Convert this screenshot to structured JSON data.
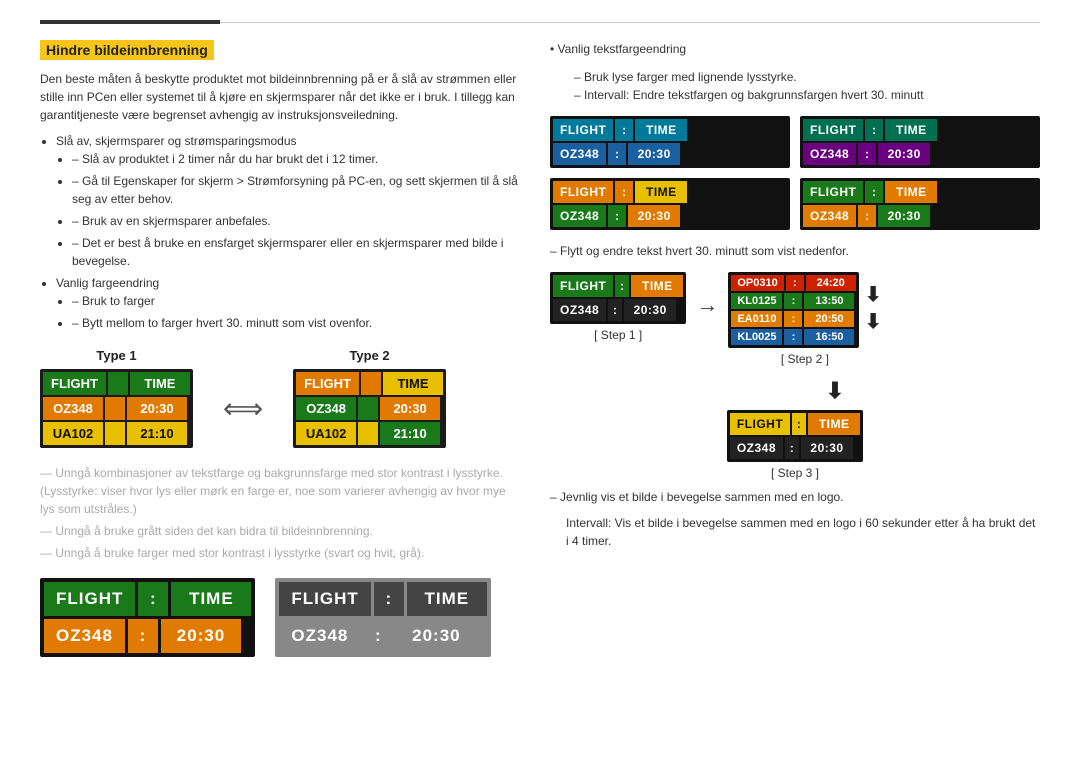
{
  "page": {
    "title": "Hindre bildeinnbrenning",
    "left": {
      "intro": "Den beste måten å beskytte produktet mot bildeinnbrenning på er å slå av strømmen eller stille inn PCen eller systemet til å kjøre en skjermsparer når det ikke er i bruk. I tillegg kan garantitjeneste være begrenset avhengig av instruksjonsveiledning.",
      "bullets": [
        {
          "text": "Slå av, skjermsparer og strømsparingsmodus",
          "sub": [
            "Slå av produktet i 2 timer når du har brukt det i 12 timer.",
            "Gå til Egenskaper for skjerm > Strømforsyning på PC-en, og sett skjermen til å slå seg av etter behov.",
            "Bruk av en skjermsparer anbefales.",
            "Det er best å bruke en ensfarget skjermsparer eller en skjermsparer med bilde i bevegelse."
          ]
        },
        {
          "text": "Vanlig fargeendring",
          "sub": [
            "Bruk to farger",
            "Bytt mellom to farger hvert 30. minutt som vist ovenfor."
          ]
        }
      ],
      "type1_label": "Type 1",
      "type2_label": "Type 2",
      "avoid_notes": [
        "Unngå kombinasjoner av tekstfarge og bakgrunnsfarge med stor kontrast i lysstyrke. (Lysstyrke: viser hvor lys eller mørk en farge er, noe som varierer avhengig av hvor mye lys som utstråles.)",
        "Unngå å bruke grått siden det kan bidra til bildeinnbrenning.",
        "Unngå å bruke farger med stor kontrast i lysstyrke (svart og hvit, grå)."
      ]
    },
    "right": {
      "vanlig_note": "Vanlig tekstfargeendring",
      "vanlig_sub": [
        "Bruk lyse farger med lignende lysstyrke.",
        "Intervall: Endre tekstfargen og bakgrunnsfargen hvert 30. minutt"
      ],
      "flytt_note": "Flytt og endre tekst hvert 30. minutt som vist nedenfor.",
      "step1_label": "[ Step 1 ]",
      "step2_label": "[ Step 2 ]",
      "step3_label": "[ Step 3 ]",
      "final_note1": "Jevnlig vis et bilde i bevegelse sammen med en logo.",
      "final_note2": "Intervall: Vis et bilde i bevegelse sammen med en logo i 60 sekunder etter å ha brukt det i 4 timer."
    },
    "boards": {
      "flight": "FLIGHT",
      "colon": ":",
      "time": "TIME",
      "oz348": "OZ348",
      "time_val": "20:30",
      "ua102": "UA102",
      "time2": "21:10"
    },
    "scroll_board": {
      "rows": [
        {
          "col1": "OP0310",
          "col2": "24:20"
        },
        {
          "col1": "KL0125",
          "col2": "13:50"
        },
        {
          "col1": "EA0110",
          "col2": "20:50"
        },
        {
          "col1": "KL0025",
          "col2": "16:50"
        }
      ]
    }
  }
}
